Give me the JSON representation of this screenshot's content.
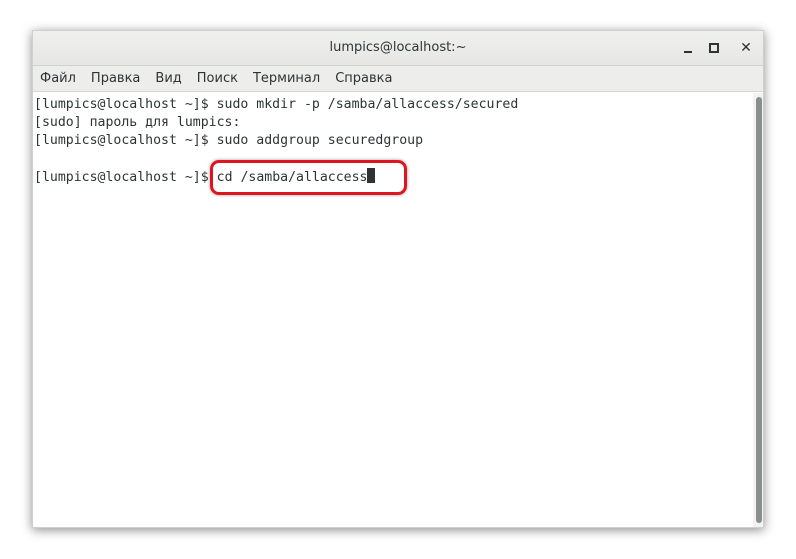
{
  "window": {
    "title": "lumpics@localhost:~",
    "minimize": "–",
    "close": "✕"
  },
  "menu": {
    "items": [
      "Файл",
      "Правка",
      "Вид",
      "Поиск",
      "Терминал",
      "Справка"
    ]
  },
  "terminal": {
    "lines": [
      "[lumpics@localhost ~]$ sudo mkdir -p /samba/allaccess/secured",
      "[sudo] пароль для lumpics:",
      "[lumpics@localhost ~]$ sudo addgroup securedgroup",
      ""
    ],
    "prompt": "[lumpics@localhost ~]$ ",
    "current_command": "cd /samba/allaccess"
  },
  "colors": {
    "highlight": "#e0141f",
    "text": "#2e3436"
  }
}
